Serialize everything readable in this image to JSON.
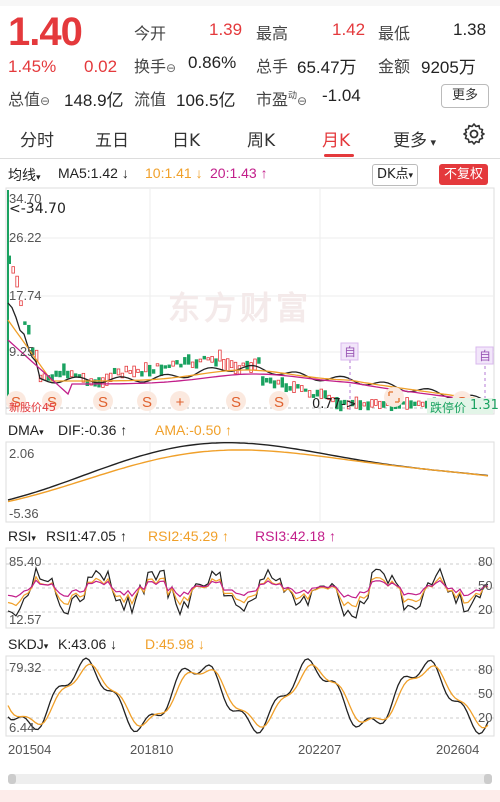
{
  "quote": {
    "price": "1.40",
    "change_pct": "1.45%",
    "change_abs": "0.02",
    "open_label": "今开",
    "open": "1.39",
    "high_label": "最高",
    "high": "1.42",
    "low_label": "最低",
    "low": "1.38",
    "turnover_label": "换手",
    "turnover": "0.86%",
    "volume_label": "总手",
    "volume": "65.47万",
    "amount_label": "金额",
    "amount": "9205万",
    "mktcap_label": "总值",
    "mktcap": "148.9亿",
    "float_label": "流值",
    "float": "106.5亿",
    "pe_label": "市盈",
    "pe_superscript": "动",
    "pe": "-1.04",
    "more_label": "更多"
  },
  "tabs": [
    {
      "label": "分时"
    },
    {
      "label": "五日"
    },
    {
      "label": "日K"
    },
    {
      "label": "周K"
    },
    {
      "label": "月K"
    },
    {
      "label": "更多"
    }
  ],
  "ma": {
    "type_label": "均线",
    "ma5": "MA5:1.42 ↓",
    "ma10": "10:1.41 ↓",
    "ma20": "20:1.43 ↑",
    "dk_label": "DK点",
    "adjust_label": "不复权"
  },
  "kline": {
    "ymax": "34.70",
    "y2": "26.22",
    "y3": "17.74",
    "y4": "9.25",
    "max_marker": "<-34.70",
    "low_marker": "0.77->",
    "right_label": "1.31",
    "limit_label": "跌停价",
    "left_label": "新股价",
    "left_value": "45",
    "zi_label": "自",
    "watermark": "东方财富"
  },
  "dma": {
    "name": "DMA",
    "dif": "DIF:-0.36 ↑",
    "ama": "AMA:-0.50 ↑",
    "top": "2.06",
    "bottom": "-5.36"
  },
  "rsi": {
    "name": "RSI",
    "rsi1": "RSI1:47.05 ↑",
    "rsi2": "RSI2:45.29 ↑",
    "rsi3": "RSI3:42.18 ↑",
    "top": "85.40",
    "bottom": "12.57",
    "r80": "80",
    "r50": "50",
    "r20": "20"
  },
  "skdj": {
    "name": "SKDJ",
    "k": "K:43.06 ↓",
    "d": "D:45.98 ↓",
    "top": "79.32",
    "bottom": "6.44",
    "r80": "80",
    "r50": "50",
    "r20": "20"
  },
  "dates": [
    "201504",
    "201810",
    "202207",
    "202604"
  ],
  "colors": {
    "red": "#e4393c",
    "green": "#1aa260",
    "orange": "#f0a02a",
    "purple": "#c21e8a"
  }
}
